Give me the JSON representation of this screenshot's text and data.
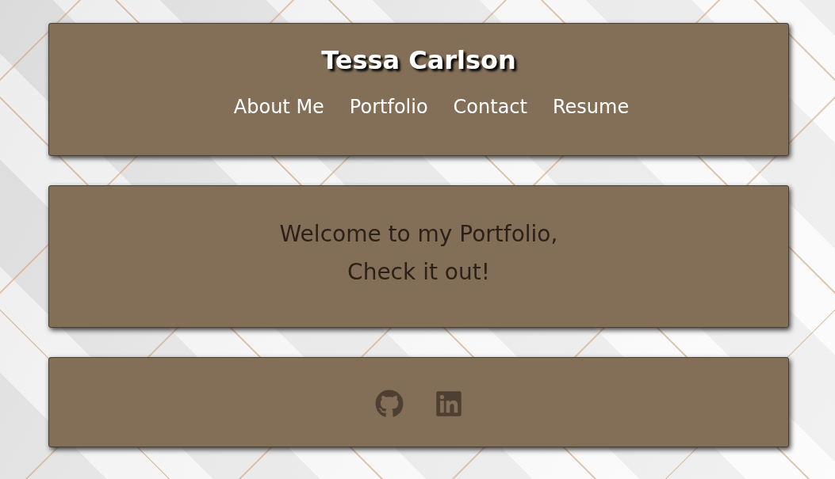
{
  "header": {
    "title": "Tessa Carlson",
    "nav": [
      {
        "label": "About Me"
      },
      {
        "label": "Portfolio"
      },
      {
        "label": "Contact"
      },
      {
        "label": "Resume"
      }
    ]
  },
  "intro": {
    "message_lines": [
      "Welcome to my Portfolio,",
      "Check it out!"
    ]
  },
  "footer": {
    "social_links": [
      {
        "kind": "github"
      },
      {
        "kind": "linkedin"
      }
    ]
  }
}
